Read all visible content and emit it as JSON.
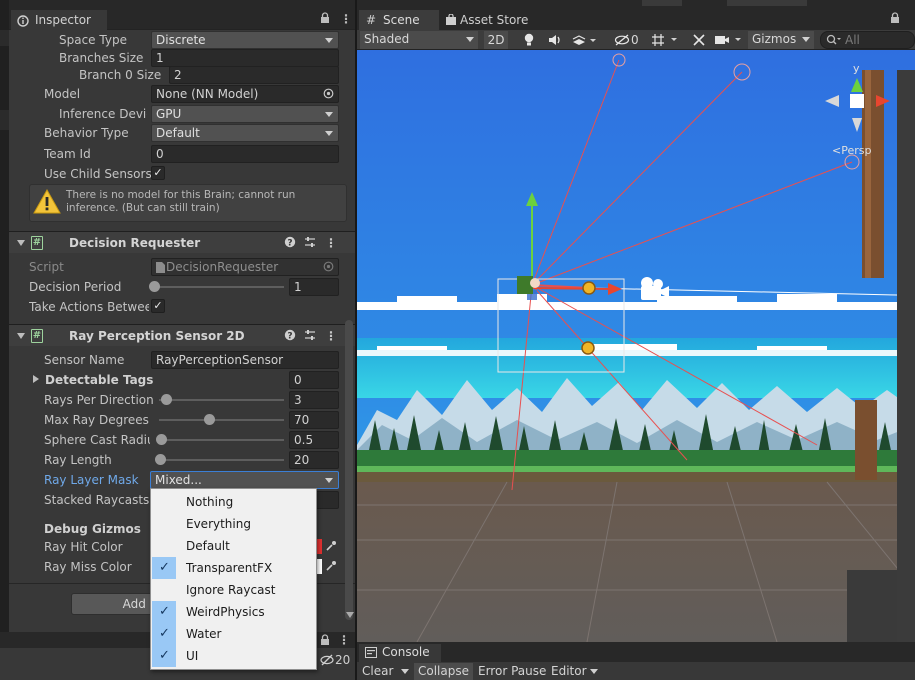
{
  "inspector": {
    "tab_title": "Inspector",
    "behavior_params": {
      "space_type": {
        "label": "Space Type",
        "value": "Discrete"
      },
      "branches_size": {
        "label": "Branches Size",
        "value": "1"
      },
      "branch0_size": {
        "label": "Branch 0 Size",
        "value": "2"
      },
      "model": {
        "label": "Model",
        "value": "None (NN Model)"
      },
      "inference_device": {
        "label": "Inference Devic",
        "value": "GPU"
      },
      "behavior_type": {
        "label": "Behavior Type",
        "value": "Default"
      },
      "team_id": {
        "label": "Team Id",
        "value": "0"
      },
      "use_child_sensors": {
        "label": "Use Child Sensors",
        "checked": true
      },
      "warning": "There is no model for this Brain; cannot run inference. (But can still train)"
    },
    "decision_requester": {
      "title": "Decision Requester",
      "script": {
        "label": "Script",
        "value": "DecisionRequester"
      },
      "decision_period": {
        "label": "Decision Period",
        "value": "1",
        "slider_fraction": 0.0
      },
      "take_actions": {
        "label": "Take Actions Betwee",
        "checked": true
      }
    },
    "ray_sensor": {
      "title": "Ray Perception Sensor 2D",
      "sensor_name": {
        "label": "Sensor Name",
        "value": "RayPerceptionSensor"
      },
      "detectable_tags": {
        "label": "Detectable Tags",
        "value": "0"
      },
      "rays_per_direction": {
        "label": "Rays Per Direction",
        "value": "3",
        "slider_fraction": 0.03
      },
      "max_ray_degrees": {
        "label": "Max Ray Degrees",
        "value": "70",
        "slider_fraction": 0.39
      },
      "sphere_cast_radius": {
        "label": "Sphere Cast Radiu",
        "value": "0.5",
        "slider_fraction": 0.01
      },
      "ray_length": {
        "label": "Ray Length",
        "value": "20",
        "slider_fraction": 0.0
      },
      "ray_layer_mask": {
        "label": "Ray Layer Mask",
        "value": "Mixed..."
      },
      "stacked_raycasts": {
        "label": "Stacked Raycasts"
      },
      "debug_gizmos": "Debug Gizmos",
      "ray_hit_color": {
        "label": "Ray Hit Color"
      },
      "ray_miss_color": {
        "label": "Ray Miss Color"
      }
    },
    "add_component": "Add Component"
  },
  "layer_menu": {
    "items": [
      {
        "label": "Nothing",
        "checked": false
      },
      {
        "label": "Everything",
        "checked": false
      },
      {
        "label": "Default",
        "checked": false
      },
      {
        "label": "TransparentFX",
        "checked": true
      },
      {
        "label": "Ignore Raycast",
        "checked": false
      },
      {
        "label": "WeirdPhysics",
        "checked": true
      },
      {
        "label": "Water",
        "checked": true
      },
      {
        "label": "UI",
        "checked": true
      }
    ]
  },
  "scene": {
    "tabs": [
      "Scene",
      "Asset Store"
    ],
    "shading_mode": "Shaded",
    "mode_2d": "2D",
    "hidden_count": "0",
    "gizmos": "Gizmos",
    "search_placeholder": "All",
    "persp_label": "Persp",
    "axis_y": "y"
  },
  "bottom_left": {
    "count": "20"
  },
  "console": {
    "tab": "Console",
    "toolbar": [
      "Clear",
      "Collapse",
      "Error Pause",
      "Editor"
    ]
  },
  "colors": {
    "sky_top": "#2f6fe0",
    "sky_mid": "#2fb5e6",
    "checkmark_bg": "#99c8f5",
    "ray_hit": "#e04040",
    "selection_label": "#6fa8e8"
  }
}
